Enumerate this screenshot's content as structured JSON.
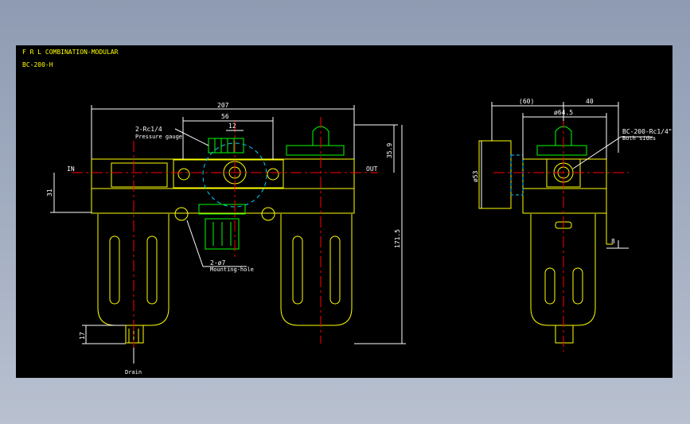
{
  "title_block": {
    "line1": "F R L  COMBINATION-MODULAR",
    "line2": "BC-200-H"
  },
  "front_view": {
    "dim_overall_width": "207",
    "dim_regulator_width": "56",
    "dim_gauge_port": "12",
    "dim_port_height": "35.9",
    "dim_inlet_height": "31",
    "dim_total_height": "171.5",
    "dim_drain": "17",
    "label_gauge_port": "2-Rc1/4",
    "label_gauge_note": "Pressure gauge",
    "label_inlet": "IN",
    "label_outlet": "OUT",
    "label_holes": "2-ø7",
    "label_holes_note": "Mounting-hole",
    "label_drain": "Drain"
  },
  "side_view": {
    "dim_depth_left": "(60)",
    "dim_depth_right": "40",
    "dim_bowl_dia": "ø64.5",
    "dim_gauge_dia": "ø53",
    "dim_bracket": "8",
    "label_port": "BC-200-Rc1/4\"",
    "label_port_note": "Both sides"
  },
  "colors": {
    "background": "#000000",
    "outline": "#ffff00",
    "centerline": "#ff0000",
    "dimension": "#ffffff",
    "knob": "#00ff00",
    "hidden": "#00d0ff"
  }
}
